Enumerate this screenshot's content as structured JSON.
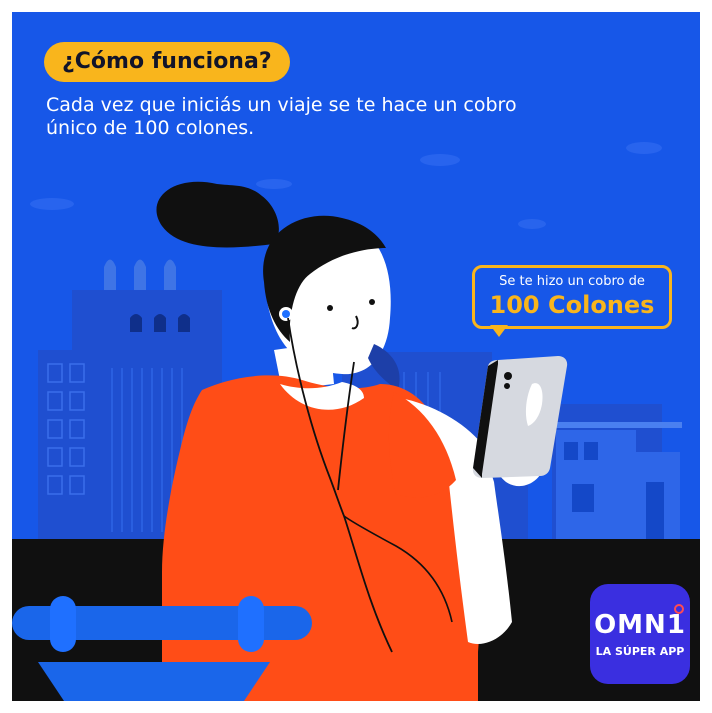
{
  "header": {
    "pill_text": "¿Cómo funciona?",
    "subtitle": "Cada vez que iniciás un viaje se te hace un cobro único de 100 colones."
  },
  "bubble": {
    "line1": "Se te hizo un cobro de",
    "line2": "100 Colones"
  },
  "logo": {
    "word": "OMN1",
    "tagline": "LA SÚPER APP"
  },
  "colors": {
    "background": "#1757e8",
    "accent": "#f9b51c",
    "shirt": "#ff4d17",
    "logo_bg": "#3a2fe0"
  }
}
